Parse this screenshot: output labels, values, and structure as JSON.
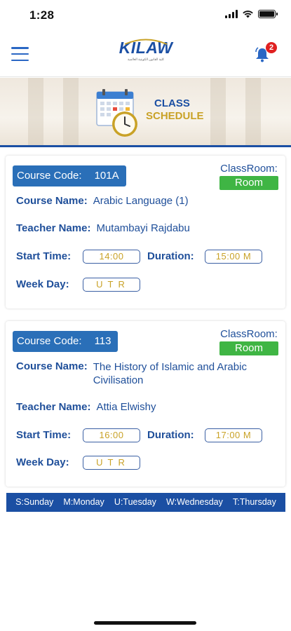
{
  "status": {
    "time": "1:28"
  },
  "header": {
    "logo_text": "KILAW",
    "logo_subtitle": "كلية القانون الكويتية العالمية",
    "notification_count": "2"
  },
  "banner": {
    "title_line1": "CLASS",
    "title_line2": "SCHEDULE"
  },
  "labels": {
    "course_code": "Course Code:",
    "classroom": "ClassRoom:",
    "course_name": "Course Name:",
    "teacher_name": "Teacher Name:",
    "start_time": "Start Time:",
    "duration": "Duration:",
    "week_day": "Week Day:"
  },
  "courses": [
    {
      "code": "101A",
      "room": "Room",
      "name": "Arabic Language (1)",
      "teacher": "Mutambayi Rajdabu",
      "start_time": "14:00",
      "duration": "15:00 M",
      "week_days": "UTR"
    },
    {
      "code": "113",
      "room": "Room",
      "name": "The History of Islamic and Arabic Civilisation",
      "teacher": "Attia Elwishy",
      "start_time": "16:00",
      "duration": "17:00 M",
      "week_days": "UTR"
    }
  ],
  "legend": [
    "S:Sunday",
    "M:Monday",
    "U:Tuesday",
    "W:Wednesday",
    "T:Thursday"
  ],
  "colors": {
    "primary": "#1b4fa3",
    "pill": "#2a6fb8",
    "room": "#3fb544",
    "gold": "#c9a227",
    "badge": "#e02020"
  }
}
